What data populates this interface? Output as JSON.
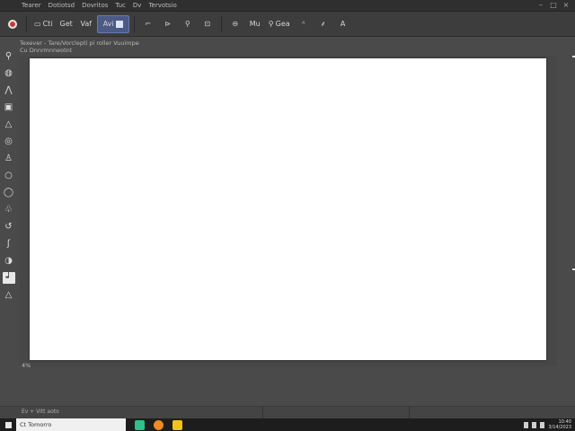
{
  "titlebar": {
    "menu": [
      "Tearer",
      "Dotiotsd",
      "Dovritos",
      "Tuc",
      "Dv",
      "Tervotsio"
    ],
    "controls": [
      "–",
      "□",
      "×"
    ]
  },
  "toolbar": {
    "logo": "app-logo",
    "buttons": [
      {
        "label": "Cti",
        "icon": "document-icon"
      },
      {
        "label": "Get",
        "icon": ""
      },
      {
        "label": "Vaf",
        "icon": ""
      },
      {
        "label": "Avi",
        "icon": "image-icon",
        "active": true
      },
      {
        "label": "",
        "icon": "crop-icon"
      },
      {
        "label": "",
        "icon": "rotate-icon"
      },
      {
        "label": "",
        "icon": "search-icon"
      },
      {
        "label": "",
        "icon": "flip-icon"
      },
      {
        "label": "",
        "icon": "layer-icon"
      },
      {
        "label": "Mu",
        "icon": ""
      },
      {
        "label": "Gea",
        "icon": "search-icon"
      },
      {
        "label": "",
        "icon": "text-icon"
      },
      {
        "label": "",
        "icon": "paint-icon"
      },
      {
        "label": "A",
        "icon": ""
      }
    ]
  },
  "optionsbar": {
    "line1": "Texever - Tare/Vorclepti pi roller Vuuimpe",
    "line2": "Cu   Dnnrmnneotnt"
  },
  "tools": [
    {
      "glyph": "⚲",
      "name": "move-tool-icon"
    },
    {
      "glyph": "◍",
      "name": "lasso-tool-icon"
    },
    {
      "glyph": "⋀",
      "name": "brush-tool-icon"
    },
    {
      "glyph": "▣",
      "name": "frame-tool-icon"
    },
    {
      "glyph": "△",
      "name": "shape-tool-icon"
    },
    {
      "glyph": "◎",
      "name": "fill-tool-icon"
    },
    {
      "glyph": "♙",
      "name": "stamp-tool-icon"
    },
    {
      "glyph": "○",
      "name": "ellipse-tool-icon"
    },
    {
      "glyph": "◯",
      "name": "circle-tool-icon"
    },
    {
      "glyph": "♧",
      "name": "blur-tool-icon"
    },
    {
      "glyph": "↺",
      "name": "history-tool-icon"
    },
    {
      "glyph": "ʃ",
      "name": "pen-tool-icon"
    },
    {
      "glyph": "◑",
      "name": "dodge-tool-icon"
    },
    {
      "glyph": "┙",
      "name": "text-tool-icon",
      "selected": true
    },
    {
      "glyph": "△",
      "name": "hand-tool-icon"
    }
  ],
  "statusbar": {
    "zoom": "4%"
  },
  "bottombar": {
    "text": "Ev + Vitt aoto"
  },
  "taskbar": {
    "search_placeholder": "Ct  Tomorro",
    "apps": [
      {
        "name": "browser-icon",
        "color": "#2ec28a"
      },
      {
        "name": "files-icon",
        "color": "#f08a24"
      },
      {
        "name": "folder-icon",
        "color": "#f2c31a"
      }
    ],
    "time": "10:40",
    "date": "3/14/2023"
  }
}
